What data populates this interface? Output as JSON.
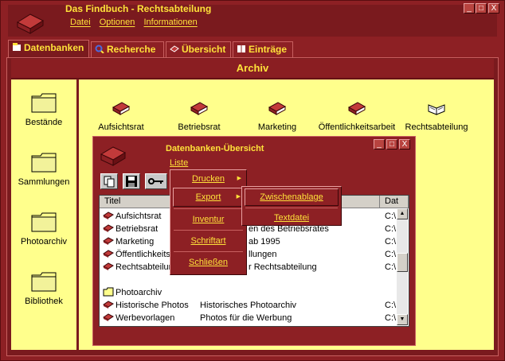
{
  "window": {
    "title": "Das Findbuch - Rechtsabteilung",
    "menu": [
      "Datei",
      "Optionen",
      "Informationen"
    ],
    "controls": [
      "_",
      "□",
      "X"
    ]
  },
  "tabs": [
    {
      "label": "Datenbanken",
      "icon": "database-icon",
      "active": true
    },
    {
      "label": "Recherche",
      "icon": "search-icon",
      "active": false
    },
    {
      "label": "Übersicht",
      "icon": "overview-icon",
      "active": false
    },
    {
      "label": "Einträge",
      "icon": "book-icon",
      "active": false
    }
  ],
  "section_title": "Archiv",
  "sidebar": [
    {
      "label": "Bestände",
      "icon": "folder-icon"
    },
    {
      "label": "Sammlungen",
      "icon": "folder-icon"
    },
    {
      "label": "Photoarchiv",
      "icon": "folder-icon"
    },
    {
      "label": "Bibliothek",
      "icon": "folder-icon"
    }
  ],
  "databases": [
    {
      "label": "Aufsichtsrat",
      "icon": "red-book-icon"
    },
    {
      "label": "Betriebsrat",
      "icon": "red-book-icon"
    },
    {
      "label": "Marketing",
      "icon": "red-book-icon"
    },
    {
      "label": "Öffentlichkeitsarbeit",
      "icon": "red-book-icon"
    },
    {
      "label": "Rechtsabteilung",
      "icon": "open-book-icon"
    }
  ],
  "inner_window": {
    "title": "Datenbanken-Übersicht",
    "menu": "Liste",
    "controls": [
      "_",
      "□",
      "X"
    ],
    "list": {
      "columns": [
        "Titel",
        "",
        "Dat"
      ],
      "rows": [
        {
          "title": "Aufsichtsrat",
          "desc": "",
          "path": "C:\\"
        },
        {
          "title": "Betriebsrat",
          "desc": "en des Betriebsrates",
          "path": "C:\\"
        },
        {
          "title": "Marketing",
          "desc": "ab 1995",
          "path": "C:\\"
        },
        {
          "title": "Öffentlichkeits",
          "desc": "llungen",
          "path": "C:\\"
        },
        {
          "title": "Rechtsabteilung",
          "desc": "r Rechtsabteilung",
          "path": "C:\\"
        },
        {
          "title": "",
          "desc": "",
          "path": ""
        },
        {
          "title": "Photoarchiv",
          "desc": "",
          "path": "",
          "folder": true
        },
        {
          "title": "Historische Photos",
          "desc": "Historisches Photoarchiv",
          "path": "C:\\"
        },
        {
          "title": "Werbevorlagen",
          "desc": "Photos für die Werbung",
          "path": "C:\\"
        }
      ]
    }
  },
  "context_menu": {
    "items": [
      "Drucken",
      "Export",
      "Inventur",
      "Schriftart",
      "Schließen"
    ],
    "submenu_arrow": "▶"
  },
  "export_submenu": {
    "items": [
      "Zwischenablage",
      "Textdatei"
    ]
  },
  "colors": {
    "frame": "#8d2024",
    "accent_text": "#ffe23a",
    "panel": "#ffff8c"
  }
}
